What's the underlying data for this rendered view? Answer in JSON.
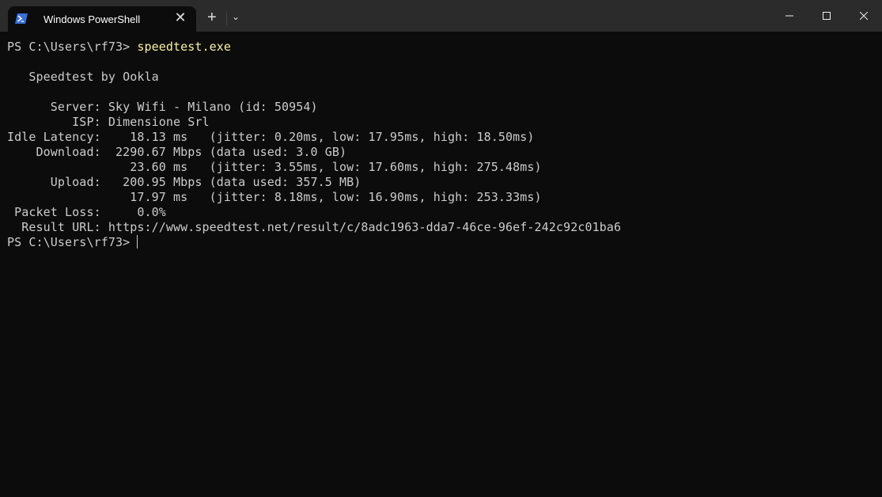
{
  "window": {
    "tab_title": "Windows PowerShell",
    "new_tab": "+",
    "dropdown": "⌄",
    "close_tab": "✕"
  },
  "terminal": {
    "prompt": "PS C:\\Users\\rf73> ",
    "command": "speedtest.exe",
    "lines": [
      "",
      "   Speedtest by Ookla",
      "",
      "      Server: Sky Wifi - Milano (id: 50954)",
      "         ISP: Dimensione Srl",
      "Idle Latency:    18.13 ms   (jitter: 0.20ms, low: 17.95ms, high: 18.50ms)",
      "    Download:  2290.67 Mbps (data used: 3.0 GB)",
      "                 23.60 ms   (jitter: 3.55ms, low: 17.60ms, high: 275.48ms)",
      "      Upload:   200.95 Mbps (data used: 357.5 MB)",
      "                 17.97 ms   (jitter: 8.18ms, low: 16.90ms, high: 253.33ms)",
      " Packet Loss:     0.0%",
      "  Result URL: https://www.speedtest.net/result/c/8adc1963-dda7-46ce-96ef-242c92c01ba6"
    ],
    "final_prompt": "PS C:\\Users\\rf73> "
  },
  "colors": {
    "background": "#0c0c0c",
    "text": "#cccccc",
    "command": "#f9f1a5"
  }
}
